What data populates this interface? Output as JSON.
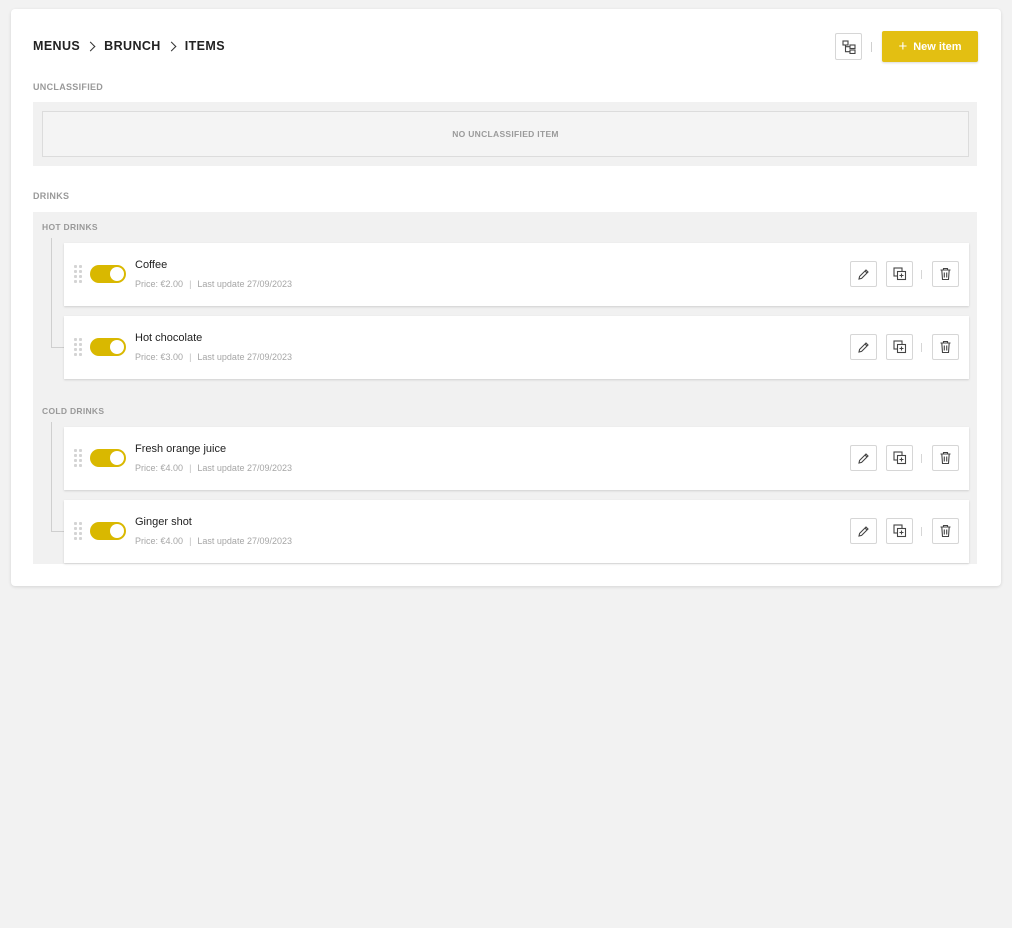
{
  "breadcrumb": [
    "MENUS",
    "BRUNCH",
    "ITEMS"
  ],
  "header": {
    "new_item_label": "New item"
  },
  "sections": {
    "unclassified_label": "UNCLASSIFIED",
    "unclassified_empty": "NO UNCLASSIFIED ITEM",
    "drinks_label": "DRINKS"
  },
  "groups": [
    {
      "label": "HOT DRINKS",
      "items": [
        {
          "name": "Coffee",
          "price_label": "Price:",
          "price": "€2.00",
          "update": "Last update 27/09/2023",
          "enabled": true
        },
        {
          "name": "Hot chocolate",
          "price_label": "Price:",
          "price": "€3.00",
          "update": "Last update 27/09/2023",
          "enabled": true
        }
      ]
    },
    {
      "label": "COLD DRINKS",
      "items": [
        {
          "name": "Fresh orange juice",
          "price_label": "Price:",
          "price": "€4.00",
          "update": "Last update 27/09/2023",
          "enabled": true
        },
        {
          "name": "Ginger shot",
          "price_label": "Price:",
          "price": "€4.00",
          "update": "Last update 27/09/2023",
          "enabled": true
        }
      ]
    }
  ],
  "colors": {
    "accent": "#e3bf12",
    "toggle_on": "#d9b800",
    "page_bg": "#f2f2f2"
  },
  "icons": {
    "tree": "tree-view-icon",
    "plus": "plus-icon",
    "drag": "drag-handle-icon",
    "edit": "pencil-icon",
    "duplicate": "duplicate-icon",
    "delete": "trash-icon"
  }
}
